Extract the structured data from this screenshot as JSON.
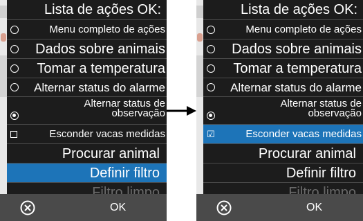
{
  "screens": [
    {
      "title": "Lista de ações OK:",
      "options": [
        {
          "label": "Menu completo de ações",
          "size": "s"
        },
        {
          "label": "Dados sobre animais",
          "size": "b"
        },
        {
          "label": "Tomar a temperatura",
          "size": "b"
        },
        {
          "label": "Alternar status do alarme",
          "size": "m"
        },
        {
          "label_line1": "Alternar status de",
          "label_line2": "observação",
          "selected": true
        }
      ],
      "checkbox": {
        "label": "Esconder vacas medidas",
        "checked": false
      },
      "actions": [
        {
          "label": "Procurar animal",
          "state": "normal"
        },
        {
          "label": "Definir filtro",
          "state": "highlighted"
        },
        {
          "label": "Filtro limpo",
          "state": "disabled"
        }
      ],
      "bottom": {
        "cancel_icon": "cancel-circle-icon",
        "ok_label": "OK"
      }
    },
    {
      "title": "Lista de ações OK:",
      "options": [
        {
          "label": "Menu completo de ações",
          "size": "s"
        },
        {
          "label": "Dados sobre animais",
          "size": "b"
        },
        {
          "label": "Tomar a temperatura",
          "size": "b"
        },
        {
          "label": "Alternar status do alarme",
          "size": "m"
        },
        {
          "label_line1": "Alternar status de",
          "label_line2": "observação",
          "selected": true
        }
      ],
      "checkbox": {
        "label": "Esconder vacas medidas",
        "checked": true
      },
      "actions": [
        {
          "label": "Procurar animal",
          "state": "normal"
        },
        {
          "label": "Definir filtro",
          "state": "normal"
        },
        {
          "label": "Filtro limpo",
          "state": "disabled"
        }
      ],
      "bottom": {
        "cancel_icon": "cancel-circle-icon",
        "ok_label": "OK"
      }
    }
  ],
  "transition_arrow_icon": "right-arrow-icon",
  "colors": {
    "highlight": "#1d74b8",
    "background": "#1c1c1c",
    "bottom_bar": "#4a4a4a",
    "disabled_text": "#6a6a6a"
  }
}
